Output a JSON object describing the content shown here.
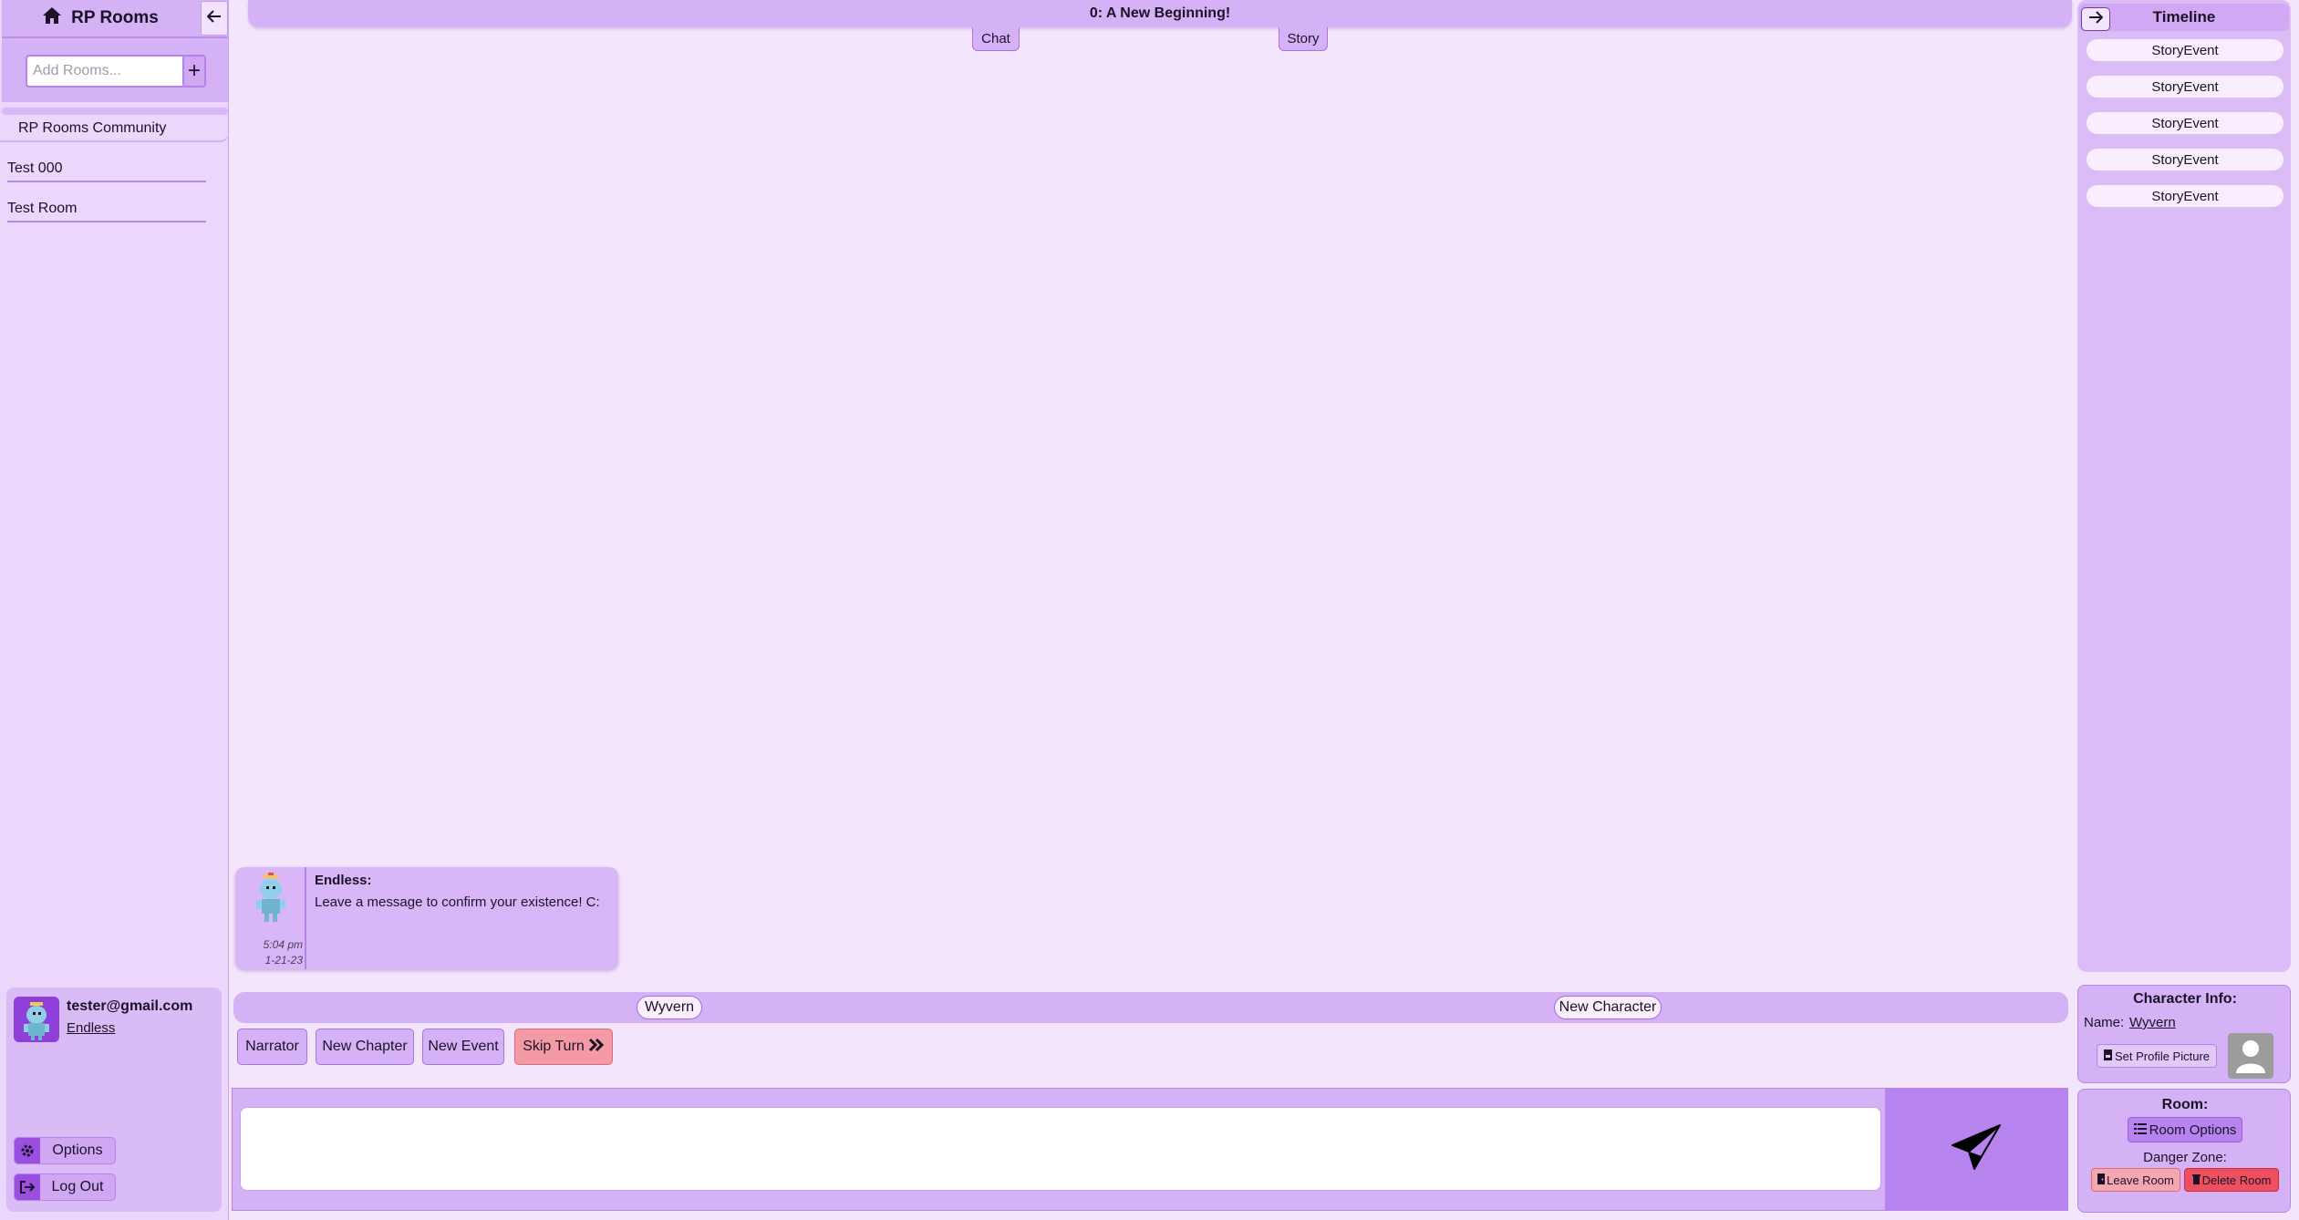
{
  "sidebar": {
    "brand": "RP Rooms",
    "add_room_placeholder": "Add Rooms...",
    "add_room_button": "+",
    "community_label": "RP Rooms Community",
    "rooms": [
      {
        "label": "Test 000"
      },
      {
        "label": "Test Room"
      }
    ]
  },
  "user": {
    "email": "tester@gmail.com",
    "character": "Endless",
    "options_label": "Options",
    "logout_label": "Log Out"
  },
  "main": {
    "chapter_title": "0: A New Beginning!",
    "tabs": [
      {
        "label": "Chat"
      },
      {
        "label": "Story"
      }
    ],
    "messages": [
      {
        "author": "Endless:",
        "text": "Leave a message to confirm your existence! C:",
        "time": "5:04 pm",
        "date": "1-21-23"
      }
    ],
    "characters": [
      {
        "label": "Wyvern"
      },
      {
        "label": "New Character"
      }
    ],
    "actions": {
      "narrator": "Narrator",
      "new_chapter": "New Chapter",
      "new_event": "New Event",
      "skip_turn": "Skip Turn"
    },
    "composer_value": ""
  },
  "timeline": {
    "title": "Timeline",
    "events": [
      {
        "label": "StoryEvent"
      },
      {
        "label": "StoryEvent"
      },
      {
        "label": "StoryEvent"
      },
      {
        "label": "StoryEvent"
      },
      {
        "label": "StoryEvent"
      }
    ]
  },
  "character_info": {
    "title": "Character Info:",
    "name_label": "Name:",
    "name_value": "Wyvern",
    "set_pfp_label": "Set Profile Picture"
  },
  "room": {
    "title": "Room:",
    "options_label": "Room Options",
    "danger_label": "Danger Zone:",
    "leave_label": "Leave Room",
    "delete_label": "Delete Room"
  },
  "colors": {
    "background": "#f3e6fc",
    "panel": "#d5b2f5",
    "accent": "#b783ef",
    "danger": "#ee5060",
    "warning": "#f39aa6"
  }
}
